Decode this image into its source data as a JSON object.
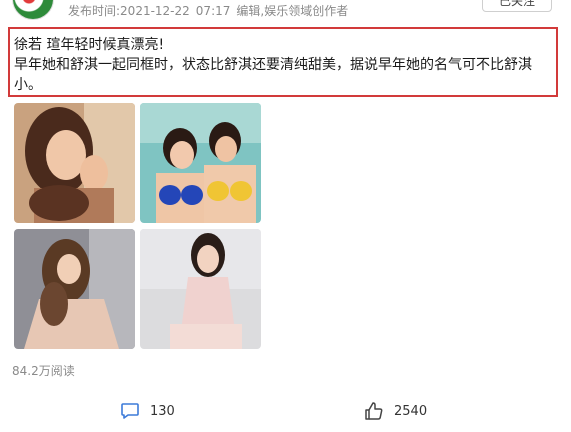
{
  "header": {
    "publish_label": "发布时间:2021-12-22",
    "publish_time": "07:17",
    "author_tag": "编辑,娱乐领域创作者",
    "follow_label": "已关注"
  },
  "post": {
    "line1": "徐若 瑄年轻时候真漂亮!",
    "line2": "早年她和舒淇一起同框时，状态比舒淇还要清纯甜美，据说早年她的名气可不比舒淇小。"
  },
  "images": [
    {
      "icon": "photo-portrait"
    },
    {
      "icon": "photo-two-women-bikini"
    },
    {
      "icon": "photo-sitting-pose"
    },
    {
      "icon": "photo-white-dress"
    }
  ],
  "stats": {
    "reads": "84.2万阅读",
    "comments": "130",
    "likes": "2540"
  },
  "colors": {
    "highlight_border": "#d23a3a",
    "icon_blue": "#3d7bd9",
    "muted_text": "#8a8a8a"
  }
}
